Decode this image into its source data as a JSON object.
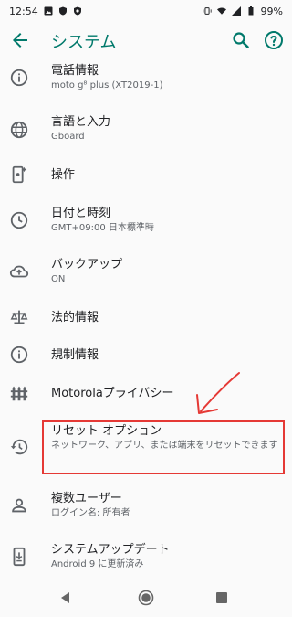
{
  "status_bar": {
    "time": "12:54",
    "battery": "99%"
  },
  "app_bar": {
    "title": "システム"
  },
  "items": [
    {
      "primary": "電話情報",
      "secondary": "moto g⁸ plus (XT2019-1)",
      "icon": "info-icon"
    },
    {
      "primary": "言語と入力",
      "secondary": "Gboard",
      "icon": "globe-icon"
    },
    {
      "primary": "操作",
      "secondary": "",
      "icon": "phone-gesture-icon"
    },
    {
      "primary": "日付と時刻",
      "secondary": "GMT+09:00 日本標準時",
      "icon": "clock-icon"
    },
    {
      "primary": "バックアップ",
      "secondary": "ON",
      "icon": "cloud-upload-icon"
    },
    {
      "primary": "法的情報",
      "secondary": "",
      "icon": "scale-icon"
    },
    {
      "primary": "規制情報",
      "secondary": "",
      "icon": "info-icon"
    },
    {
      "primary": "Motorolaプライバシー",
      "secondary": "",
      "icon": "fence-icon"
    },
    {
      "primary": "リセット オプション",
      "secondary": "ネットワーク、アプリ、または端末をリセットできます",
      "icon": "history-icon"
    },
    {
      "primary": "複数ユーザー",
      "secondary": "ログイン名: 所有者",
      "icon": "person-icon"
    },
    {
      "primary": "システムアップデート",
      "secondary": "Android 9 に更新済み",
      "icon": "system-update-icon"
    }
  ],
  "colors": {
    "accent": "#00796b",
    "annotation": "#e53935"
  }
}
